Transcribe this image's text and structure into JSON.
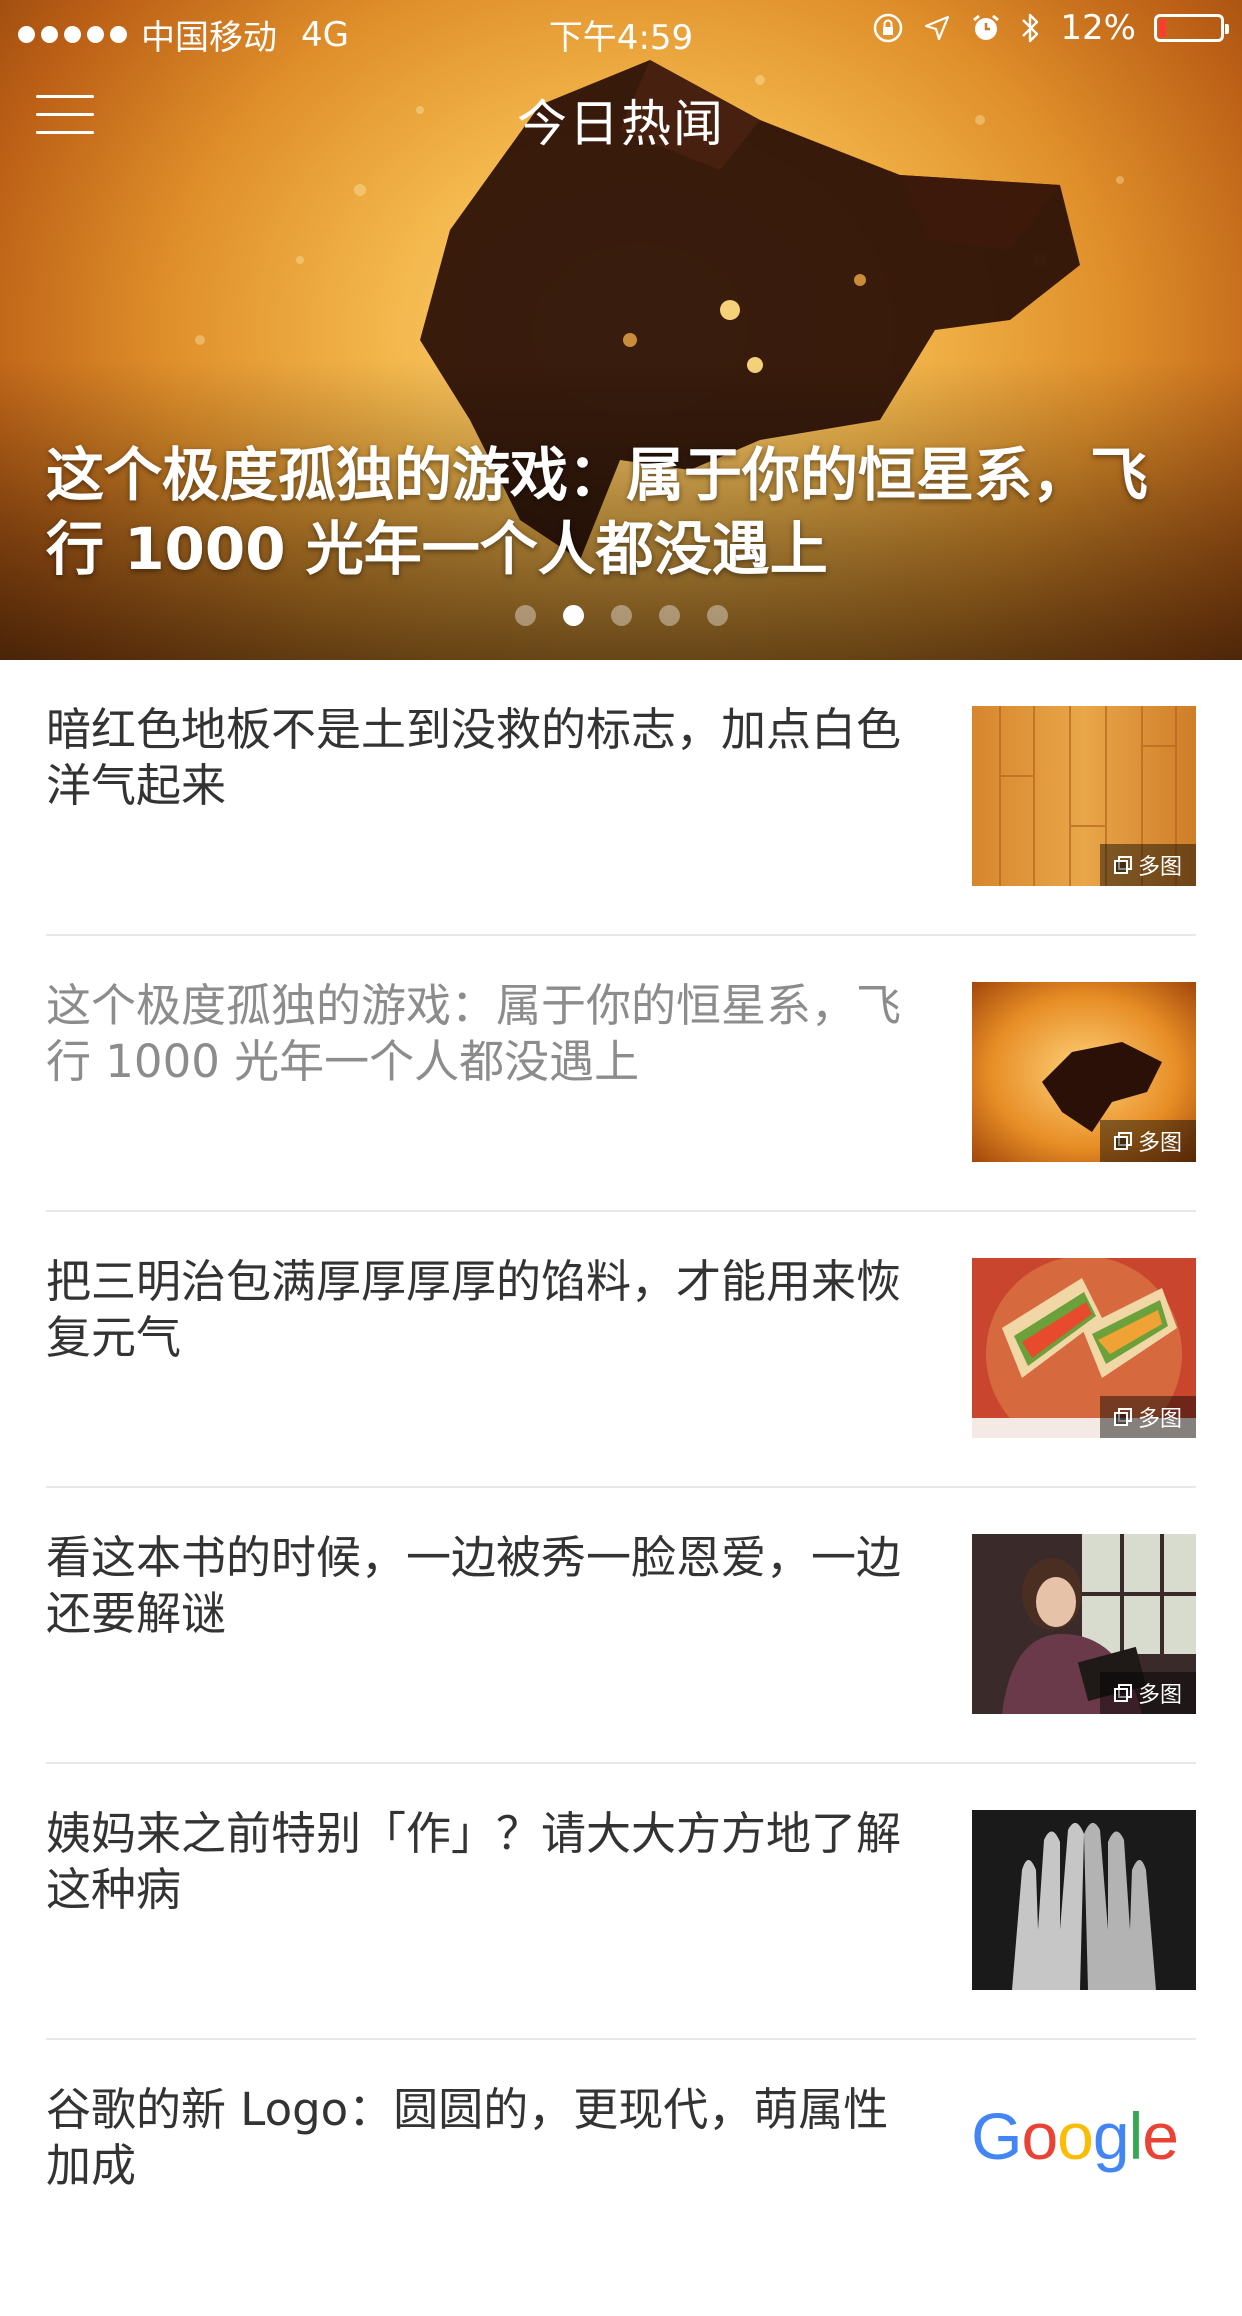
{
  "status_bar": {
    "carrier": "中国移动",
    "network": "4G",
    "time": "下午4:59",
    "battery_text": "12%",
    "battery_level": 0.12,
    "battery_color": "#ff3b30"
  },
  "header": {
    "title": "今日热闻",
    "menu_icon": "hamburger-icon"
  },
  "hero": {
    "caption": "这个极度孤独的游戏：属于你的恒星系，飞行 1000 光年一个人都没遇上",
    "page_count": 5,
    "active_page": 1
  },
  "news": [
    {
      "title": "暗红色地板不是土到没救的标志，加点白色洋气起来",
      "read": false,
      "badge": "多图",
      "thumb": "wood-floor"
    },
    {
      "title": "这个极度孤独的游戏：属于你的恒星系，飞行 1000 光年一个人都没遇上",
      "read": true,
      "badge": "多图",
      "thumb": "spaceship-sun"
    },
    {
      "title": "把三明治包满厚厚厚厚的馅料，才能用来恢复元气",
      "read": false,
      "badge": "多图",
      "thumb": "sandwich"
    },
    {
      "title": "看这本书的时候，一边被秀一脸恩爱，一边还要解谜",
      "read": false,
      "badge": "多图",
      "thumb": "woman-reading"
    },
    {
      "title": "姨妈来之前特别「作」？请大大方方地了解这种病",
      "read": false,
      "badge": "",
      "thumb": "hands-face"
    },
    {
      "title": "谷歌的新 Logo：圆圆的，更现代，萌属性加成",
      "read": false,
      "badge": "",
      "thumb": "google-logo"
    }
  ],
  "google_logo": {
    "letters": [
      "G",
      "o",
      "o",
      "g",
      "l",
      "e"
    ],
    "colors": [
      "#4285f4",
      "#ea4335",
      "#fbbc05",
      "#4285f4",
      "#34a853",
      "#ea4335"
    ]
  }
}
